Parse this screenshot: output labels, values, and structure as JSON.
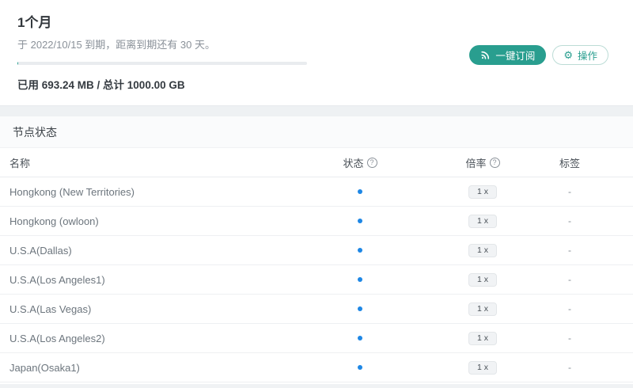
{
  "plan_card": {
    "title": "1个月",
    "expiry_note": "于 2022/10/15 到期，距离到期还有 30 天。",
    "usage_label": "已用 693.24 MB / 总计 1000.00 GB",
    "usage_percent": 0.07,
    "buttons": {
      "subscribe": "一键订阅",
      "actions": "操作"
    }
  },
  "nodes_section": {
    "title": "节点状态",
    "columns": {
      "name": "名称",
      "status": "状态",
      "rate": "倍率",
      "tags": "标签"
    },
    "help_glyph": "?",
    "gear_glyph": "⚙",
    "rows": [
      {
        "name": "Hongkong (New Territories)",
        "status": "online",
        "rate": "1 x",
        "tag": "-"
      },
      {
        "name": "Hongkong (owloon)",
        "status": "online",
        "rate": "1 x",
        "tag": "-"
      },
      {
        "name": "U.S.A(Dallas)",
        "status": "online",
        "rate": "1 x",
        "tag": "-"
      },
      {
        "name": "U.S.A(Los Angeles1)",
        "status": "online",
        "rate": "1 x",
        "tag": "-"
      },
      {
        "name": "U.S.A(Las Vegas)",
        "status": "online",
        "rate": "1 x",
        "tag": "-"
      },
      {
        "name": "U.S.A(Los Angeles2)",
        "status": "online",
        "rate": "1 x",
        "tag": "-"
      },
      {
        "name": "Japan(Osaka1)",
        "status": "online",
        "rate": "1 x",
        "tag": "-"
      }
    ]
  },
  "colors": {
    "accent": "#299e8f",
    "status_online": "#1e87e5",
    "progress_track": "#e9ecef"
  }
}
